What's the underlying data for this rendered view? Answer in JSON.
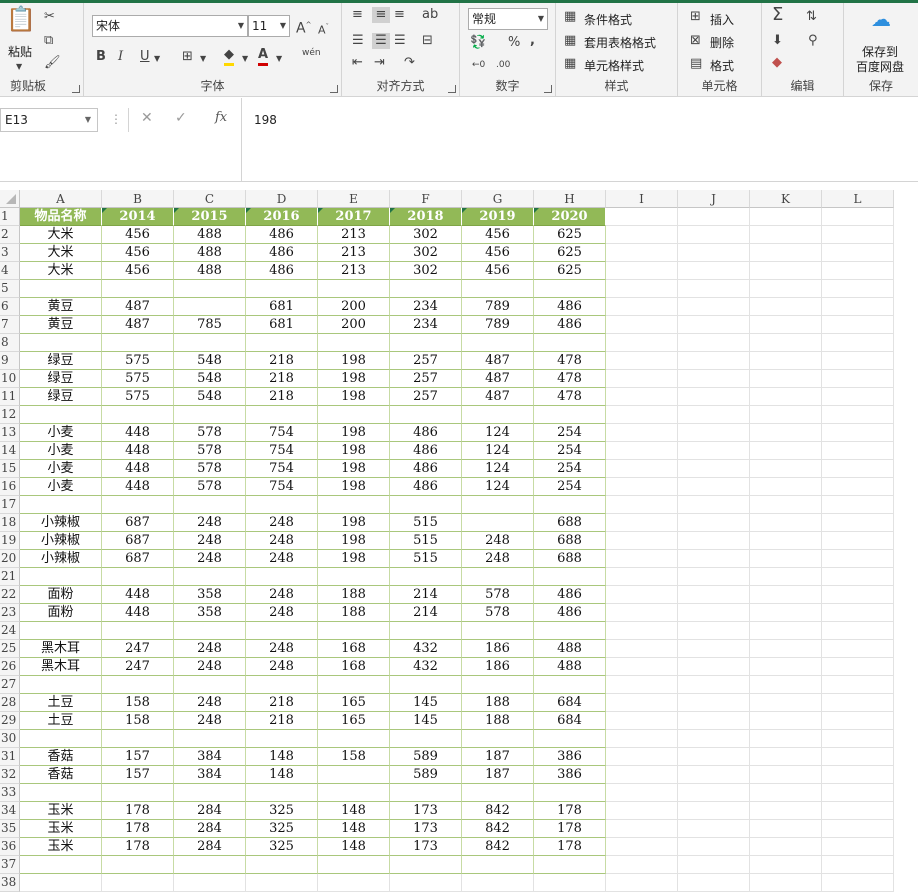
{
  "ribbon": {
    "clipboard": {
      "paste": "粘贴",
      "group": "剪贴板"
    },
    "font": {
      "name": "宋体",
      "size": "11",
      "bold": "B",
      "italic": "I",
      "underline": "U",
      "fontColorA": "A",
      "wen": "wén",
      "group": "字体"
    },
    "align": {
      "group": "对齐方式"
    },
    "number": {
      "format": "常规",
      "percent": "%",
      "comma": ",",
      "group": "数字"
    },
    "styles": {
      "conditional": "条件格式",
      "table": "套用表格格式",
      "cell": "单元格样式",
      "group": "样式"
    },
    "cells": {
      "insert": "插入",
      "delete": "删除",
      "format": "格式",
      "group": "单元格"
    },
    "editing": {
      "group": "编辑"
    },
    "save": {
      "line1": "保存到",
      "line2": "百度网盘",
      "group": "保存"
    }
  },
  "formula_bar": {
    "name_box": "E13",
    "content": "198",
    "fx": "fx"
  },
  "columns": [
    "A",
    "B",
    "C",
    "D",
    "E",
    "F",
    "G",
    "H",
    "I",
    "J",
    "K",
    "L"
  ],
  "header_row": [
    "物品名称",
    "2014",
    "2015",
    "2016",
    "2017",
    "2018",
    "2019",
    "2020"
  ],
  "rows": [
    [
      "大米",
      "456",
      "488",
      "486",
      "213",
      "302",
      "456",
      "625"
    ],
    [
      "大米",
      "456",
      "488",
      "486",
      "213",
      "302",
      "456",
      "625"
    ],
    [
      "大米",
      "456",
      "488",
      "486",
      "213",
      "302",
      "456",
      "625"
    ],
    [
      "",
      "",
      "",
      "",
      "",
      "",
      "",
      ""
    ],
    [
      "黄豆",
      "487",
      "",
      "681",
      "200",
      "234",
      "789",
      "486"
    ],
    [
      "黄豆",
      "487",
      "785",
      "681",
      "200",
      "234",
      "789",
      "486"
    ],
    [
      "",
      "",
      "",
      "",
      "",
      "",
      "",
      ""
    ],
    [
      "绿豆",
      "575",
      "548",
      "218",
      "198",
      "257",
      "487",
      "478"
    ],
    [
      "绿豆",
      "575",
      "548",
      "218",
      "198",
      "257",
      "487",
      "478"
    ],
    [
      "绿豆",
      "575",
      "548",
      "218",
      "198",
      "257",
      "487",
      "478"
    ],
    [
      "",
      "",
      "",
      "",
      "",
      "",
      "",
      ""
    ],
    [
      "小麦",
      "448",
      "578",
      "754",
      "198",
      "486",
      "124",
      "254"
    ],
    [
      "小麦",
      "448",
      "578",
      "754",
      "198",
      "486",
      "124",
      "254"
    ],
    [
      "小麦",
      "448",
      "578",
      "754",
      "198",
      "486",
      "124",
      "254"
    ],
    [
      "小麦",
      "448",
      "578",
      "754",
      "198",
      "486",
      "124",
      "254"
    ],
    [
      "",
      "",
      "",
      "",
      "",
      "",
      "",
      ""
    ],
    [
      "小辣椒",
      "687",
      "248",
      "248",
      "198",
      "515",
      "",
      "688"
    ],
    [
      "小辣椒",
      "687",
      "248",
      "248",
      "198",
      "515",
      "248",
      "688"
    ],
    [
      "小辣椒",
      "687",
      "248",
      "248",
      "198",
      "515",
      "248",
      "688"
    ],
    [
      "",
      "",
      "",
      "",
      "",
      "",
      "",
      ""
    ],
    [
      "面粉",
      "448",
      "358",
      "248",
      "188",
      "214",
      "578",
      "486"
    ],
    [
      "面粉",
      "448",
      "358",
      "248",
      "188",
      "214",
      "578",
      "486"
    ],
    [
      "",
      "",
      "",
      "",
      "",
      "",
      "",
      ""
    ],
    [
      "黑木耳",
      "247",
      "248",
      "248",
      "168",
      "432",
      "186",
      "488"
    ],
    [
      "黑木耳",
      "247",
      "248",
      "248",
      "168",
      "432",
      "186",
      "488"
    ],
    [
      "",
      "",
      "",
      "",
      "",
      "",
      "",
      ""
    ],
    [
      "土豆",
      "158",
      "248",
      "218",
      "165",
      "145",
      "188",
      "684"
    ],
    [
      "土豆",
      "158",
      "248",
      "218",
      "165",
      "145",
      "188",
      "684"
    ],
    [
      "",
      "",
      "",
      "",
      "",
      "",
      "",
      ""
    ],
    [
      "香菇",
      "157",
      "384",
      "148",
      "158",
      "589",
      "187",
      "386"
    ],
    [
      "香菇",
      "157",
      "384",
      "148",
      "",
      "589",
      "187",
      "386"
    ],
    [
      "",
      "",
      "",
      "",
      "",
      "",
      "",
      ""
    ],
    [
      "玉米",
      "178",
      "284",
      "325",
      "148",
      "173",
      "842",
      "178"
    ],
    [
      "玉米",
      "178",
      "284",
      "325",
      "148",
      "173",
      "842",
      "178"
    ],
    [
      "玉米",
      "178",
      "284",
      "325",
      "148",
      "173",
      "842",
      "178"
    ],
    [
      "",
      "",
      "",
      "",
      "",
      "",
      "",
      ""
    ]
  ],
  "colors": {
    "header_fill": "#92b957",
    "accent": "#217346"
  }
}
